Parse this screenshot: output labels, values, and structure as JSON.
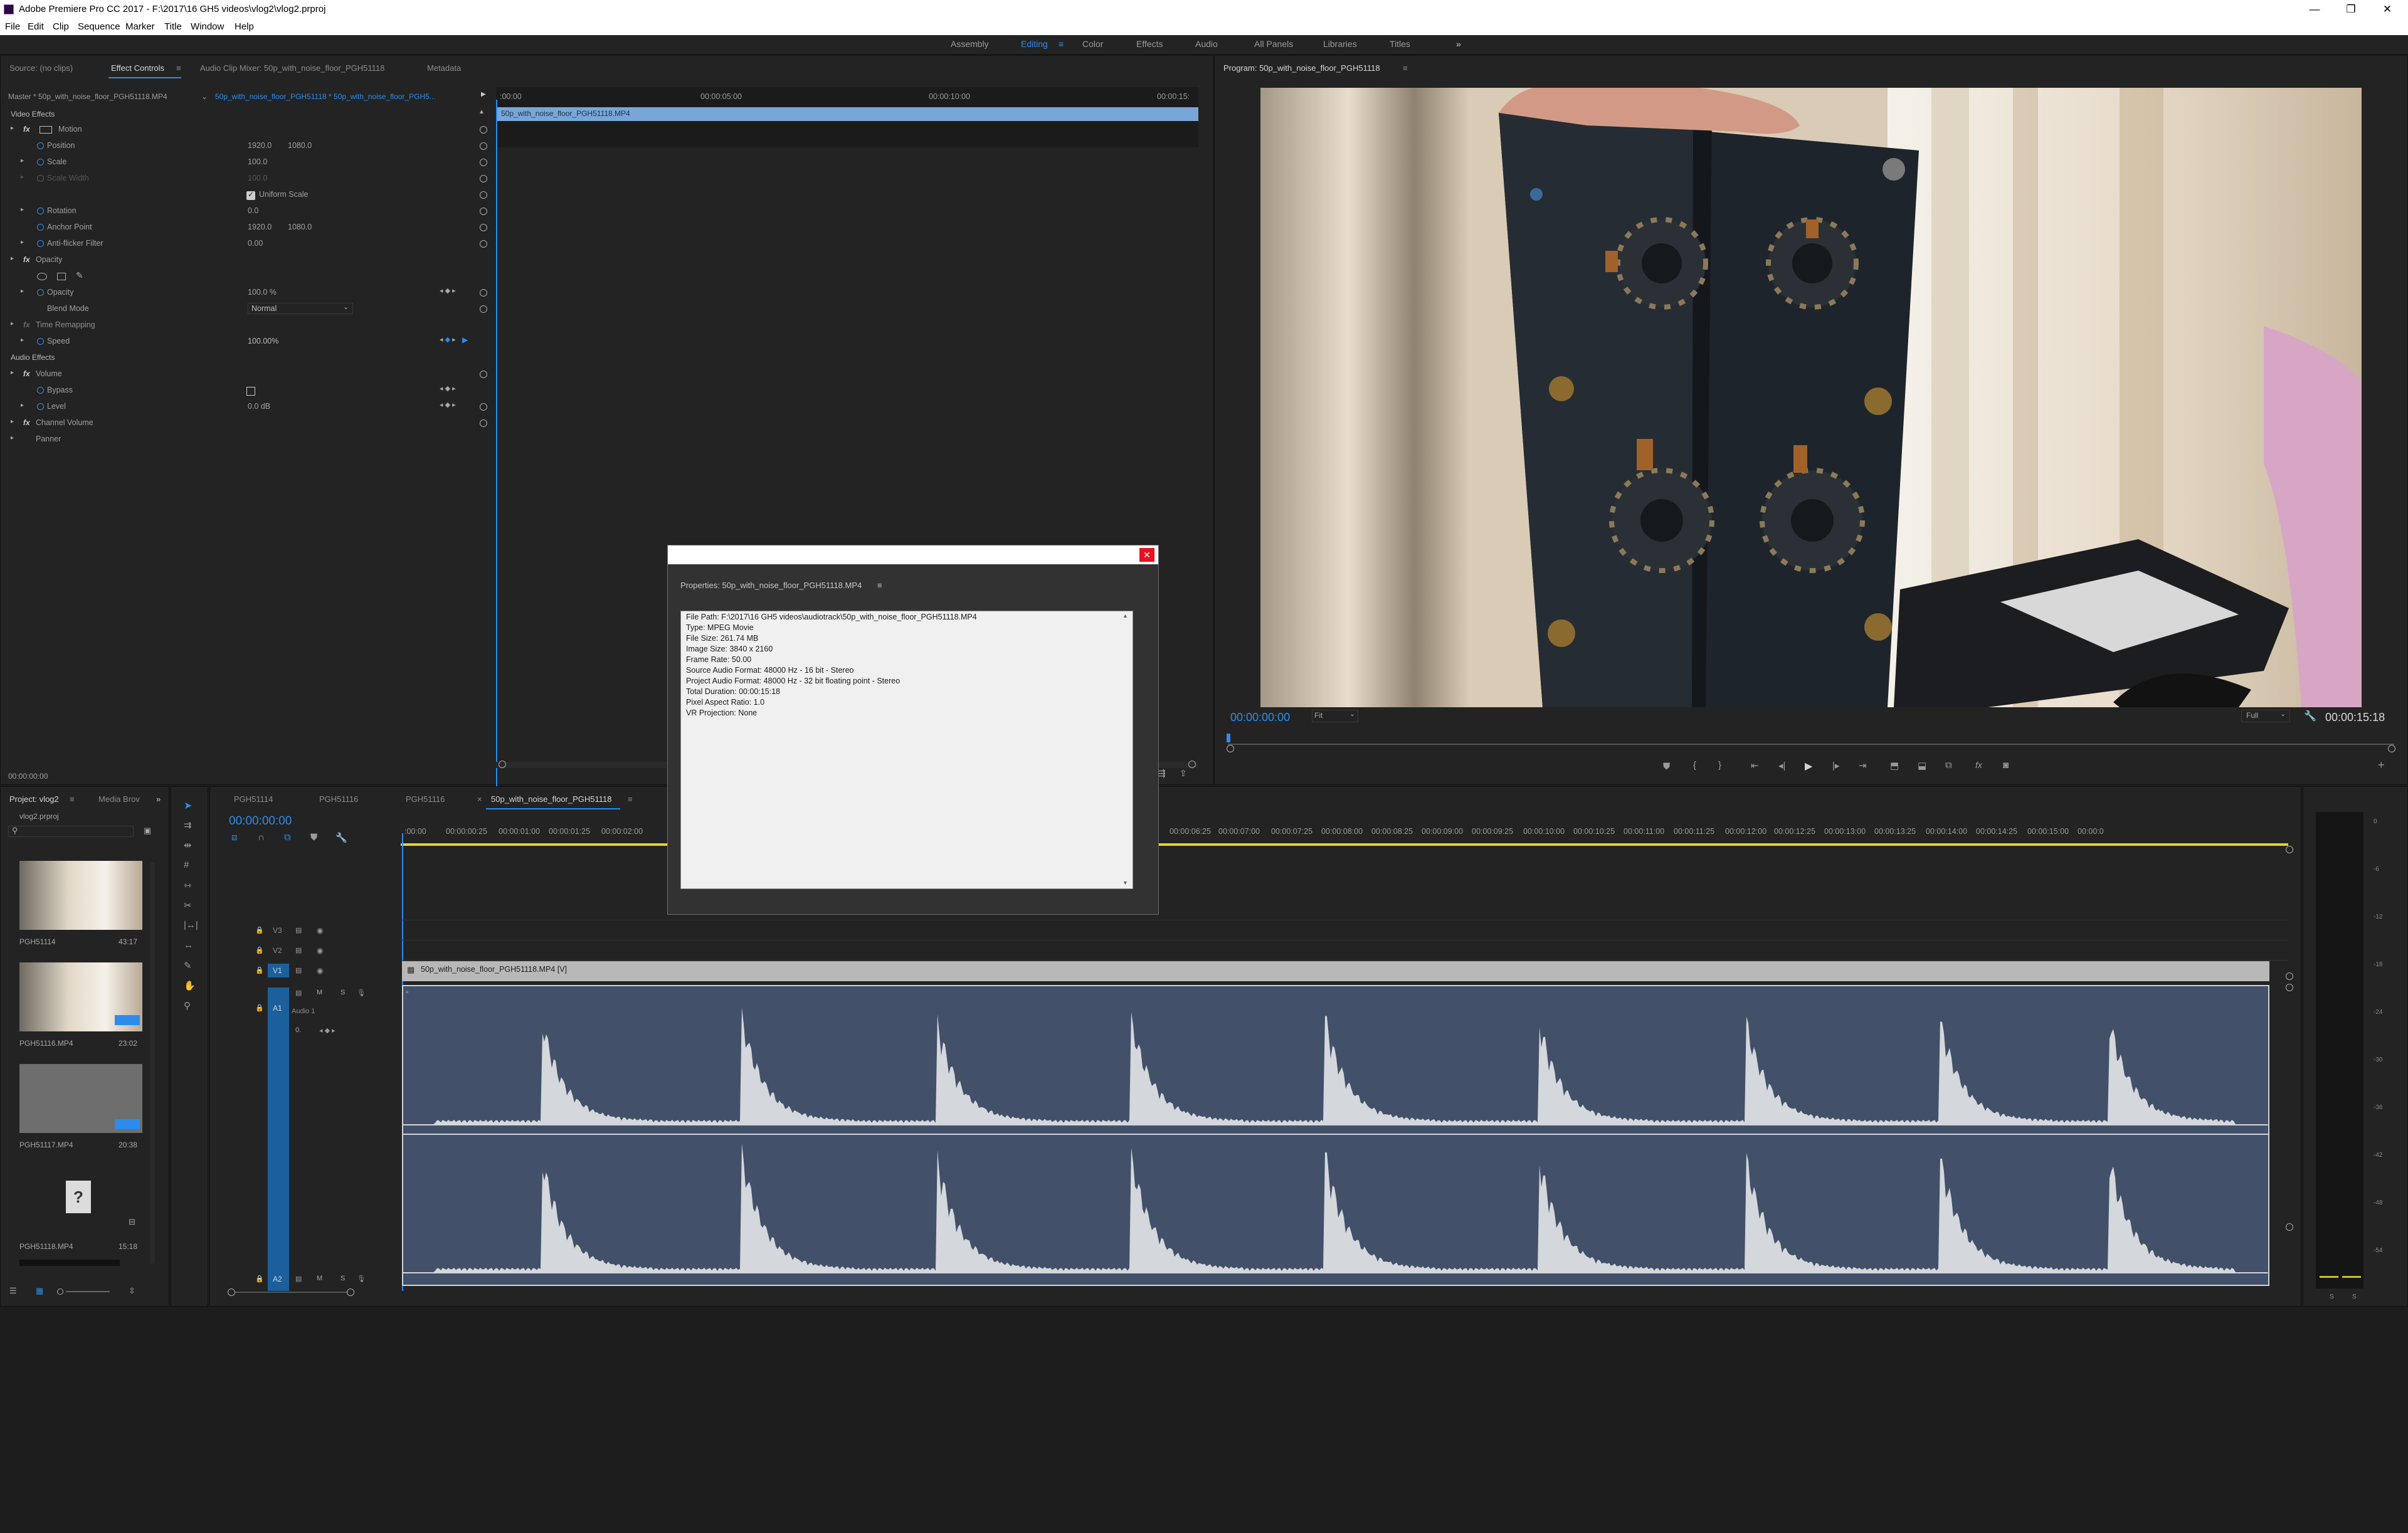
{
  "window": {
    "title": "Adobe Premiere Pro CC 2017 - F:\\2017\\16 GH5 videos\\vlog2\\vlog2.prproj"
  },
  "menu": [
    "File",
    "Edit",
    "Clip",
    "Sequence",
    "Marker",
    "Title",
    "Window",
    "Help"
  ],
  "workspaces": [
    {
      "label": "Assembly",
      "active": false
    },
    {
      "label": "Editing",
      "active": true
    },
    {
      "label": "Color",
      "active": false
    },
    {
      "label": "Effects",
      "active": false
    },
    {
      "label": "Audio",
      "active": false
    },
    {
      "label": "All Panels",
      "active": false
    },
    {
      "label": "Libraries",
      "active": false
    },
    {
      "label": "Titles",
      "active": false
    }
  ],
  "source_panel": {
    "tabs": [
      "Source: (no clips)",
      "Effect Controls",
      "Audio Clip Mixer: 50p_with_noise_floor_PGH51118",
      "Metadata"
    ],
    "master": "Master * 50p_with_noise_floor_PGH51118.MP4",
    "clip": "50p_with_noise_floor_PGH51118 * 50p_with_noise_floor_PGH5...",
    "ruler": [
      ":00:00",
      "00:00:05:00",
      "00:00:10:00",
      "00:00:15:"
    ],
    "clip_bar": "50p_with_noise_floor_PGH51118.MP4",
    "video_effects": "Video Effects",
    "motion": "Motion",
    "position": {
      "label": "Position",
      "x": "1920.0",
      "y": "1080.0"
    },
    "scale": {
      "label": "Scale",
      "value": "100.0"
    },
    "scale_width": {
      "label": "Scale Width",
      "value": "100.0"
    },
    "uniform_scale": "Uniform Scale",
    "rotation": {
      "label": "Rotation",
      "value": "0.0"
    },
    "anchor": {
      "label": "Anchor Point",
      "x": "1920.0",
      "y": "1080.0"
    },
    "antiflicker": {
      "label": "Anti-flicker Filter",
      "value": "0.00"
    },
    "opacity_group": "Opacity",
    "opacity": {
      "label": "Opacity",
      "value": "100.0 %"
    },
    "blend": {
      "label": "Blend Mode",
      "value": "Normal"
    },
    "time_remap": "Time Remapping",
    "speed": {
      "label": "Speed",
      "value": "100.00%"
    },
    "audio_effects": "Audio Effects",
    "volume": "Volume",
    "bypass": "Bypass",
    "level": {
      "label": "Level",
      "value": "0.0 dB"
    },
    "channel_volume": "Channel Volume",
    "panner": "Panner",
    "timecode": "00:00:00:00"
  },
  "program": {
    "title": "Program: 50p_with_noise_floor_PGH51118",
    "timecode": "00:00:00:00",
    "fit": "Fit",
    "quality": "Full",
    "duration": "00:00:15:18"
  },
  "project": {
    "tabs": [
      "Project: vlog2",
      "Media Brov"
    ],
    "file": "vlog2.prproj",
    "items": [
      {
        "name": "PGH51114",
        "duration": "43:17"
      },
      {
        "name": "PGH51116.MP4",
        "duration": "23:02"
      },
      {
        "name": "PGH51117.MP4",
        "duration": "20:38"
      },
      {
        "name": "PGH51118.MP4",
        "duration": "15:18"
      }
    ]
  },
  "timeline": {
    "tabs": [
      "PGH51114",
      "PGH51116",
      "PGH51116",
      "50p_with_noise_floor_PGH51118"
    ],
    "timecode": "00:00:00:00",
    "ruler": [
      ":00:00",
      "00:00:00:25",
      "00:00:01:00",
      "00:00:01:25",
      "00:00:02:00",
      "00:00:06:25",
      "00:00:07:00",
      "00:00:07:25",
      "00:00:08:00",
      "00:00:08:25",
      "00:00:09:00",
      "00:00:09:25",
      "00:00:10:00",
      "00:00:10:25",
      "00:00:11:00",
      "00:00:11:25",
      "00:00:12:00",
      "00:00:12:25",
      "00:00:13:00",
      "00:00:13:25",
      "00:00:14:00",
      "00:00:14:25",
      "00:00:15:00",
      "00:00:0"
    ],
    "tracks": {
      "v3": "V3",
      "v2": "V2",
      "v1": "V1",
      "a1": "A1",
      "a1_name": "Audio 1",
      "a2": "A2",
      "m": "M",
      "s": "S"
    },
    "video_clip": "50p_with_noise_floor_PGH51118.MP4 [V]"
  },
  "meter": [
    "0",
    "-6",
    "-12",
    "-18",
    "-24",
    "-30",
    "-36",
    "-42",
    "-48",
    "-54"
  ],
  "meter_bottom": [
    "S",
    "S"
  ],
  "dialog": {
    "title": "Properties: 50p_with_noise_floor_PGH51118.MP4",
    "lines": [
      "File Path: F:\\2017\\16 GH5 videos\\audiotrack\\50p_with_noise_floor_PGH51118.MP4",
      "Type: MPEG Movie",
      "File Size: 261.74 MB",
      "Image Size: 3840 x 2160",
      "Frame Rate: 50.00",
      "Source Audio Format: 48000 Hz - 16 bit - Stereo",
      "Project Audio Format: 48000 Hz - 32 bit floating point - Stereo",
      "Total Duration: 00:00:15:18",
      "Pixel Aspect Ratio: 1.0",
      "VR Projection: None"
    ],
    "close": "✕"
  },
  "colors": {
    "accent": "#2d8ceb",
    "panel": "#232323",
    "clip_audio": "#42506a",
    "clip_video": "#b8b8b8"
  }
}
